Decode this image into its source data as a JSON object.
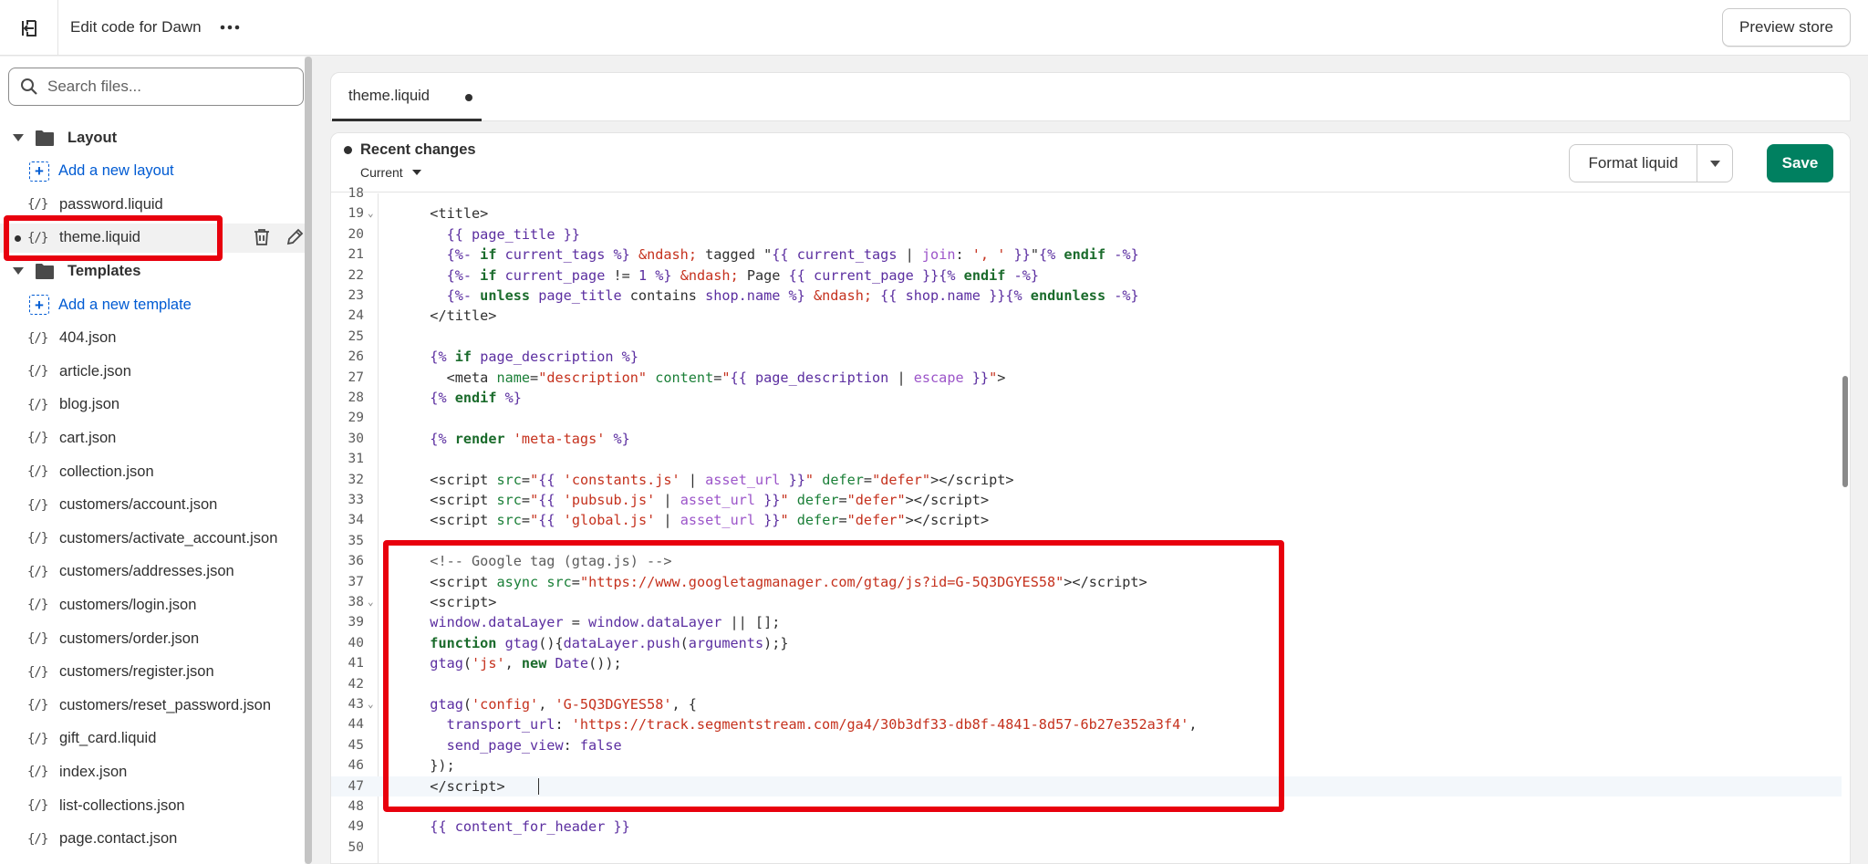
{
  "topbar": {
    "title": "Edit code for Dawn",
    "preview_label": "Preview store"
  },
  "sidebar": {
    "search_placeholder": "Search files...",
    "layout_folder": "Layout",
    "add_layout": "Add a new layout",
    "layout_files": [
      "password.liquid",
      "theme.liquid"
    ],
    "templates_folder": "Templates",
    "add_template": "Add a new template",
    "template_files": [
      "404.json",
      "article.json",
      "blog.json",
      "cart.json",
      "collection.json",
      "customers/account.json",
      "customers/activate_account.json",
      "customers/addresses.json",
      "customers/login.json",
      "customers/order.json",
      "customers/register.json",
      "customers/reset_password.json",
      "gift_card.liquid",
      "index.json",
      "list-collections.json",
      "page.contact.json"
    ],
    "file_icon_glyph": "{/}"
  },
  "editor": {
    "tab_label": "theme.liquid",
    "recent_changes": "Recent changes",
    "version_select": "Current",
    "format_label": "Format liquid",
    "save_label": "Save",
    "code_lines": [
      {
        "n": "18",
        "fold": false,
        "html": ""
      },
      {
        "n": "19",
        "fold": true,
        "html": "  <span class=\"tok-tag\">&lt;title&gt;</span>"
      },
      {
        "n": "20",
        "fold": false,
        "html": "    <span class=\"tok-punc\">{{</span> <span class=\"tok-var\">page_title</span> <span class=\"tok-punc\">}}</span>"
      },
      {
        "n": "21",
        "fold": false,
        "html": "    <span class=\"tok-punc\">{%-</span> <span class=\"tok-kw\">if</span> <span class=\"tok-var\">current_tags</span> <span class=\"tok-punc\">%}</span> <span class=\"tok-ent\">&amp;ndash;</span> tagged \"<span class=\"tok-punc\">{{</span> <span class=\"tok-var\">current_tags</span> | <span class=\"tok-filter\">join</span>: <span class=\"tok-str\">', '</span> <span class=\"tok-punc\">}}</span>\"<span class=\"tok-punc\">{%</span> <span class=\"tok-kw\">endif</span> <span class=\"tok-punc\">-%}</span>"
      },
      {
        "n": "22",
        "fold": false,
        "html": "    <span class=\"tok-punc\">{%-</span> <span class=\"tok-kw\">if</span> <span class=\"tok-var\">current_page</span> != <span class=\"tok-var\">1</span> <span class=\"tok-punc\">%}</span> <span class=\"tok-ent\">&amp;ndash;</span> Page <span class=\"tok-punc\">{{</span> <span class=\"tok-var\">current_page</span> <span class=\"tok-punc\">}}{%</span> <span class=\"tok-kw\">endif</span> <span class=\"tok-punc\">-%}</span>"
      },
      {
        "n": "23",
        "fold": false,
        "html": "    <span class=\"tok-punc\">{%-</span> <span class=\"tok-kw\">unless</span> <span class=\"tok-var\">page_title</span> contains <span class=\"tok-var\">shop.name</span> <span class=\"tok-punc\">%}</span> <span class=\"tok-ent\">&amp;ndash;</span> <span class=\"tok-punc\">{{</span> <span class=\"tok-var\">shop.name</span> <span class=\"tok-punc\">}}{%</span> <span class=\"tok-kw\">endunless</span> <span class=\"tok-punc\">-%}</span>"
      },
      {
        "n": "24",
        "fold": false,
        "html": "  <span class=\"tok-tag\">&lt;/title&gt;</span>"
      },
      {
        "n": "25",
        "fold": false,
        "html": ""
      },
      {
        "n": "26",
        "fold": false,
        "html": "  <span class=\"tok-punc\">{%</span> <span class=\"tok-kw\">if</span> <span class=\"tok-var\">page_description</span> <span class=\"tok-punc\">%}</span>"
      },
      {
        "n": "27",
        "fold": false,
        "html": "    <span class=\"tok-tag\">&lt;meta</span> <span class=\"tok-attr\">name</span>=<span class=\"tok-str\">\"description\"</span> <span class=\"tok-attr\">content</span>=<span class=\"tok-str\">\"</span><span class=\"tok-punc\">{{</span> <span class=\"tok-var\">page_description</span> | <span class=\"tok-filter\">escape</span> <span class=\"tok-punc\">}}</span><span class=\"tok-str\">\"</span><span class=\"tok-tag\">&gt;</span>"
      },
      {
        "n": "28",
        "fold": false,
        "html": "  <span class=\"tok-punc\">{%</span> <span class=\"tok-kw\">endif</span> <span class=\"tok-punc\">%}</span>"
      },
      {
        "n": "29",
        "fold": false,
        "html": ""
      },
      {
        "n": "30",
        "fold": false,
        "html": "  <span class=\"tok-punc\">{%</span> <span class=\"tok-kw\">render</span> <span class=\"tok-str\">'meta-tags'</span> <span class=\"tok-punc\">%}</span>"
      },
      {
        "n": "31",
        "fold": false,
        "html": ""
      },
      {
        "n": "32",
        "fold": false,
        "html": "  <span class=\"tok-tag\">&lt;script</span> <span class=\"tok-attr\">src</span>=<span class=\"tok-str\">\"</span><span class=\"tok-punc\">{{</span> <span class=\"tok-str\">'constants.js'</span> | <span class=\"tok-filter\">asset_url</span> <span class=\"tok-punc\">}}</span><span class=\"tok-str\">\"</span> <span class=\"tok-attr\">defer</span>=<span class=\"tok-str\">\"defer\"</span><span class=\"tok-tag\">&gt;&lt;/script&gt;</span>"
      },
      {
        "n": "33",
        "fold": false,
        "html": "  <span class=\"tok-tag\">&lt;script</span> <span class=\"tok-attr\">src</span>=<span class=\"tok-str\">\"</span><span class=\"tok-punc\">{{</span> <span class=\"tok-str\">'pubsub.js'</span> | <span class=\"tok-filter\">asset_url</span> <span class=\"tok-punc\">}}</span><span class=\"tok-str\">\"</span> <span class=\"tok-attr\">defer</span>=<span class=\"tok-str\">\"defer\"</span><span class=\"tok-tag\">&gt;&lt;/script&gt;</span>"
      },
      {
        "n": "34",
        "fold": false,
        "html": "  <span class=\"tok-tag\">&lt;script</span> <span class=\"tok-attr\">src</span>=<span class=\"tok-str\">\"</span><span class=\"tok-punc\">{{</span> <span class=\"tok-str\">'global.js'</span> | <span class=\"tok-filter\">asset_url</span> <span class=\"tok-punc\">}}</span><span class=\"tok-str\">\"</span> <span class=\"tok-attr\">defer</span>=<span class=\"tok-str\">\"defer\"</span><span class=\"tok-tag\">&gt;&lt;/script&gt;</span>"
      },
      {
        "n": "35",
        "fold": false,
        "html": ""
      },
      {
        "n": "36",
        "fold": false,
        "html": "  <span class=\"tok-cmt\">&lt;!-- Google tag (gtag.js) --&gt;</span>"
      },
      {
        "n": "37",
        "fold": false,
        "html": "  <span class=\"tok-tag\">&lt;script</span> <span class=\"tok-attr\">async</span> <span class=\"tok-attr\">src</span>=<span class=\"tok-str\">\"https://www.googletagmanager.com/gtag/js?id=G-5Q3DGYES58\"</span><span class=\"tok-tag\">&gt;&lt;/script&gt;</span>"
      },
      {
        "n": "38",
        "fold": true,
        "html": "  <span class=\"tok-tag\">&lt;script&gt;</span>"
      },
      {
        "n": "39",
        "fold": false,
        "html": "  <span class=\"tok-var\">window.dataLayer</span> = <span class=\"tok-var\">window.dataLayer</span> || [];"
      },
      {
        "n": "40",
        "fold": false,
        "html": "  <span class=\"tok-kw\">function</span> <span class=\"tok-var\">gtag</span>(){<span class=\"tok-var\">dataLayer.push</span>(<span class=\"tok-var\">arguments</span>);}"
      },
      {
        "n": "41",
        "fold": false,
        "html": "  <span class=\"tok-var\">gtag</span>(<span class=\"tok-str\">'js'</span>, <span class=\"tok-kw\">new</span> <span class=\"tok-var\">Date</span>());"
      },
      {
        "n": "42",
        "fold": false,
        "html": ""
      },
      {
        "n": "43",
        "fold": true,
        "html": "  <span class=\"tok-var\">gtag</span>(<span class=\"tok-str\">'config'</span>, <span class=\"tok-str\">'G-5Q3DGYES58'</span>, {"
      },
      {
        "n": "44",
        "fold": false,
        "html": "    <span class=\"tok-var\">transport_url</span>: <span class=\"tok-str\">'https://track.segmentstream.com/ga4/30b3df33-db8f-4841-8d57-6b27e352a3f4'</span>,"
      },
      {
        "n": "45",
        "fold": false,
        "html": "    <span class=\"tok-var\">send_page_view</span>: <span class=\"tok-var\">false</span>"
      },
      {
        "n": "46",
        "fold": false,
        "html": "  });"
      },
      {
        "n": "47",
        "fold": false,
        "html": "  <span class=\"tok-tag\">&lt;/script&gt;</span>",
        "active": true
      },
      {
        "n": "48",
        "fold": false,
        "html": ""
      },
      {
        "n": "49",
        "fold": false,
        "html": "  <span class=\"tok-punc\">{{</span> <span class=\"tok-var\">content_for_header</span> <span class=\"tok-punc\">}}</span>"
      },
      {
        "n": "50",
        "fold": false,
        "html": ""
      }
    ]
  },
  "colors": {
    "save_green": "#008060",
    "link_blue": "#005bd3",
    "highlight_red": "#e8000d"
  },
  "icons": {
    "exit": "exit-icon",
    "more": "more-horizontal-icon",
    "search": "search-icon",
    "folder": "folder-icon",
    "add_file": "add-file-icon",
    "file": "liquid-file-icon",
    "delete": "trash-icon",
    "rename": "pencil-icon"
  }
}
